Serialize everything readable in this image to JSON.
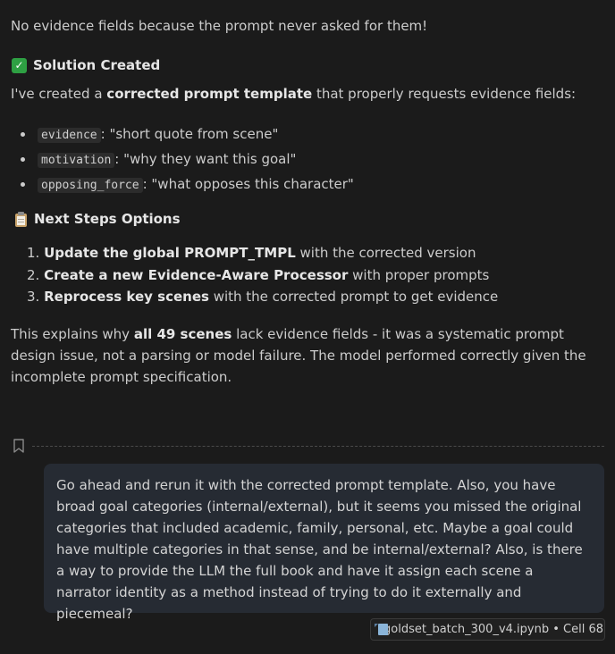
{
  "intro_line": "No evidence fields because the prompt never asked for them!",
  "solution": {
    "icon": "check-mark-icon",
    "heading": "Solution Created",
    "para_prefix": "I've created a ",
    "para_bold": "corrected prompt template",
    "para_suffix": " that properly requests evidence fields:",
    "fields": [
      {
        "code": "evidence",
        "text": ": \"short quote from scene\""
      },
      {
        "code": "motivation",
        "text": ": \"why they want this goal\""
      },
      {
        "code": "opposing_force",
        "text": ": \"what opposes this character\""
      }
    ]
  },
  "next_steps": {
    "icon": "clipboard-icon",
    "heading": "Next Steps Options",
    "items": [
      {
        "num": "1.",
        "bold": "Update the global PROMPT_TMPL",
        "rest": " with the corrected version"
      },
      {
        "num": "2.",
        "bold": "Create a new Evidence-Aware Processor",
        "rest": " with proper prompts"
      },
      {
        "num": "3.",
        "bold": "Reprocess key scenes",
        "rest": " with the corrected prompt to get evidence"
      }
    ]
  },
  "summary": {
    "prefix": "This explains why ",
    "bold": "all 49 scenes",
    "suffix": " lack evidence fields - it was a systematic prompt design issue, not a parsing or model failure. The model performed correctly given the incomplete prompt specification."
  },
  "user_message": "Go ahead and rerun it with the corrected prompt template. Also, you have broad goal categories (internal/external), but it seems you missed the original categories that included academic, family, personal, etc. Maybe a goal could have multiple categories in that sense, and be internal/external? Also, is there a way to provide the LLM the full book and have it assign each scene a narrator identity as a method instead of trying to do it externally and piecemeal?",
  "context_chip": {
    "icon": "notebook-file-icon",
    "label": "goldset_batch_300_v4.ipynb • Cell 68"
  },
  "colors": {
    "background": "#1b1b1b",
    "bubble": "#262b33",
    "check": "#2ea043"
  }
}
